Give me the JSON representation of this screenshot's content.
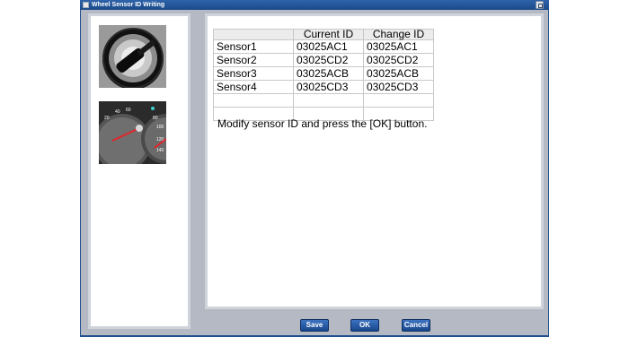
{
  "window": {
    "title": "Wheel Sensor ID Writing"
  },
  "table": {
    "headers": [
      "",
      "Current ID",
      "Change ID"
    ],
    "rows": [
      [
        "Sensor1",
        "03025AC1",
        "03025AC1"
      ],
      [
        "Sensor2",
        "03025CD2",
        "03025CD2"
      ],
      [
        "Sensor3",
        "03025ACB",
        "03025ACB"
      ],
      [
        "Sensor4",
        "03025CD3",
        "03025CD3"
      ],
      [
        "",
        "",
        ""
      ],
      [
        "",
        "",
        ""
      ]
    ]
  },
  "instruction": "Modify sensor ID and press the [OK] button.",
  "gauge": {
    "ticks": [
      "20",
      "40",
      "60",
      "80",
      "100",
      "120",
      "140"
    ]
  },
  "buttons": {
    "save": "Save",
    "ok": "OK",
    "cancel": "Cancel"
  },
  "colors": {
    "title_bar": "#1f4f8f",
    "button": "#2a5ba8",
    "client_bg": "#b4b9c3"
  }
}
